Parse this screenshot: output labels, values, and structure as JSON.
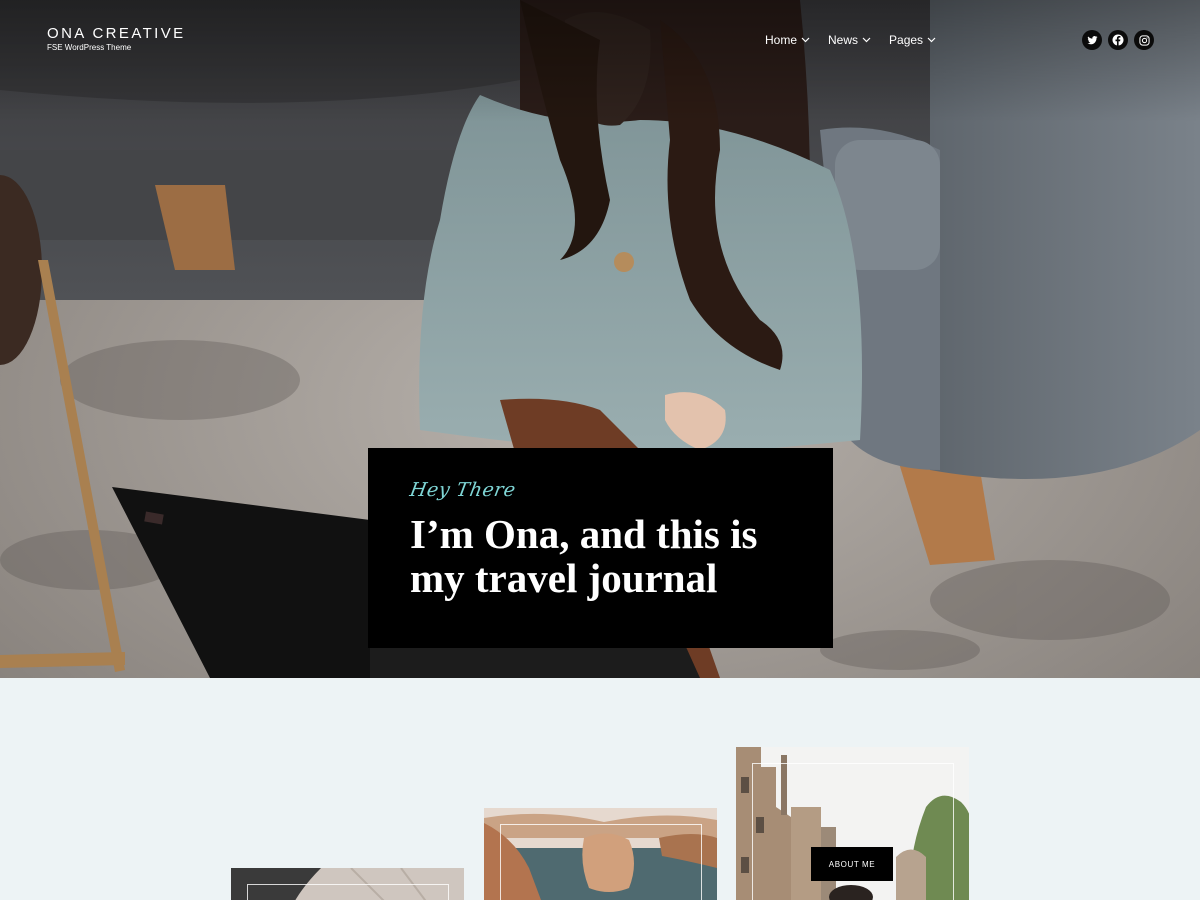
{
  "header": {
    "site_title": "ONA CREATIVE",
    "tagline": "FSE WordPress Theme",
    "nav": [
      {
        "label": "Home"
      },
      {
        "label": "News"
      },
      {
        "label": "Pages"
      }
    ],
    "social": [
      {
        "icon": "twitter-icon"
      },
      {
        "icon": "facebook-icon"
      },
      {
        "icon": "instagram-icon"
      }
    ]
  },
  "hero": {
    "kicker": "Hey There",
    "title_line1": "I’m Ona, and this is",
    "title_line2": "my travel journal"
  },
  "gallery": {
    "about_button": "ABOUT ME"
  },
  "colors": {
    "accent": "#7fd6d6",
    "card_bg": "#000000",
    "section_bg": "#edf3f5"
  }
}
